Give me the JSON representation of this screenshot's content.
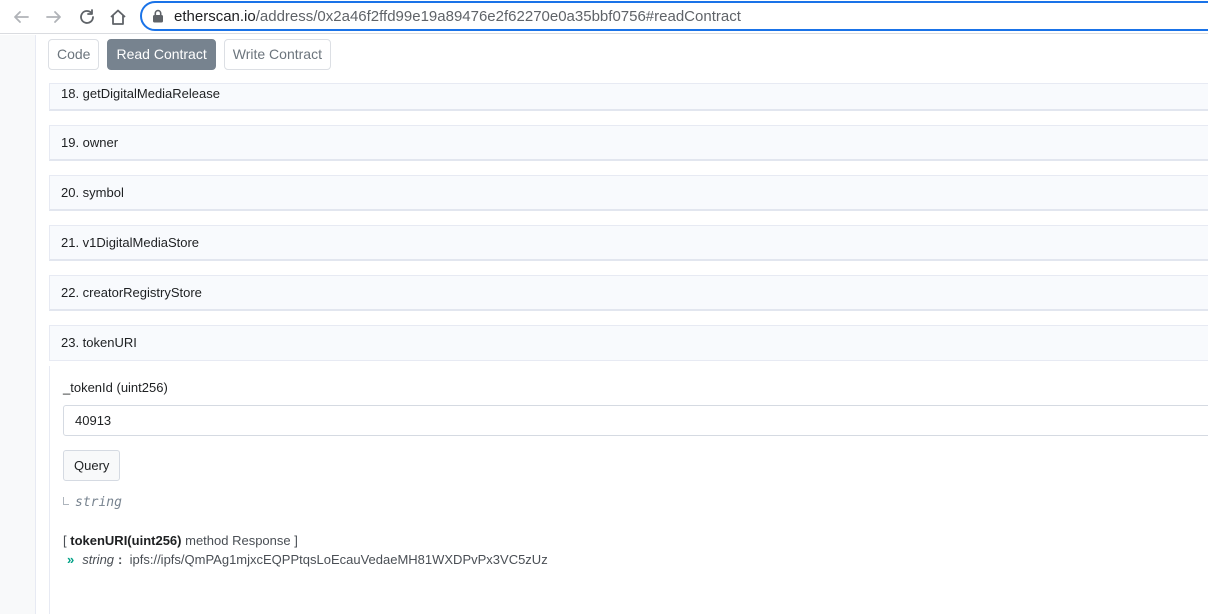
{
  "browser": {
    "url_host": "etherscan.io",
    "url_path": "/address/0x2a46f2ffd99e19a89476e2f62270e0a35bbf0756#readContract"
  },
  "tabs": [
    {
      "label": "Code"
    },
    {
      "label": "Read Contract",
      "active": true
    },
    {
      "label": "Write Contract"
    }
  ],
  "functions": [
    {
      "label": "18. getDigitalMediaRelease"
    },
    {
      "label": "19. owner"
    },
    {
      "label": "20. symbol"
    },
    {
      "label": "21. v1DigitalMediaStore"
    },
    {
      "label": "22. creatorRegistryStore"
    },
    {
      "label": "23. tokenURI"
    }
  ],
  "token_uri": {
    "param_label": "_tokenId (uint256)",
    "param_value": "40913",
    "query_label": "Query",
    "return_type": "string",
    "response_prefix": "[",
    "response_method": "tokenURI(uint256)",
    "response_suffix": "method Response ]",
    "response_type": "string",
    "response_colon": ":",
    "response_value": "ipfs://ipfs/QmPAg1mjxcEQPPtqsLoEcauVedaeMH81WXDPvPx3VC5zUz"
  },
  "colors": {
    "active_tab": "#77838f",
    "url_focus": "#1a73e8",
    "response_arrow": "#00a186"
  }
}
